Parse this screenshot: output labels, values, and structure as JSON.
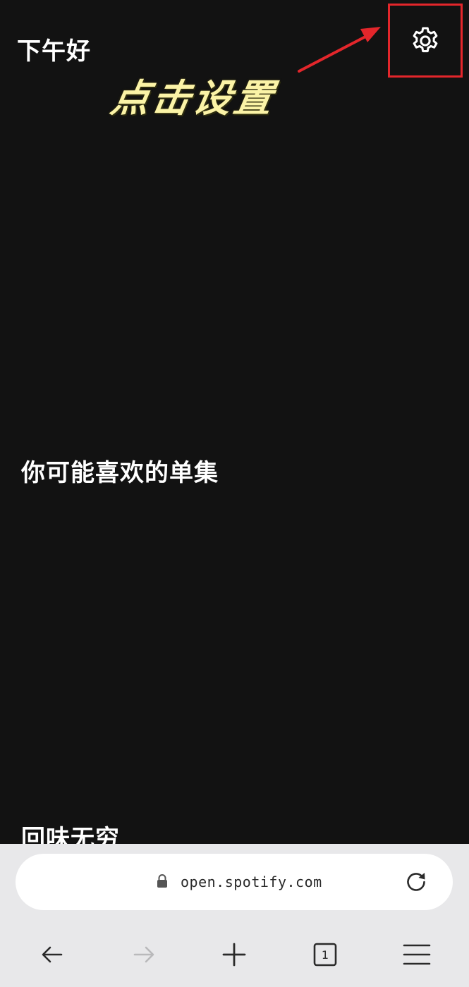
{
  "header": {
    "greeting": "下午好",
    "settings_icon": "gear-icon"
  },
  "annotation": {
    "callout_text": "点击设置",
    "callout_color": "#fbf3a6",
    "highlight_color": "#e3262b"
  },
  "sections": [
    {
      "title": "你可能喜欢的单集"
    },
    {
      "title": "回味无穷"
    }
  ],
  "browser": {
    "url": "open.spotify.com",
    "lock_icon": "lock-icon",
    "reload_icon": "reload-icon",
    "tab_count": "1",
    "nav": {
      "back_icon": "arrow-left-icon",
      "forward_icon": "arrow-right-icon",
      "new_tab_icon": "plus-icon",
      "tabs_icon": "tabs-icon",
      "menu_icon": "hamburger-menu-icon"
    }
  },
  "colors": {
    "background": "#121212",
    "browser_bar": "#e8e8ea",
    "text": "#ffffff"
  }
}
